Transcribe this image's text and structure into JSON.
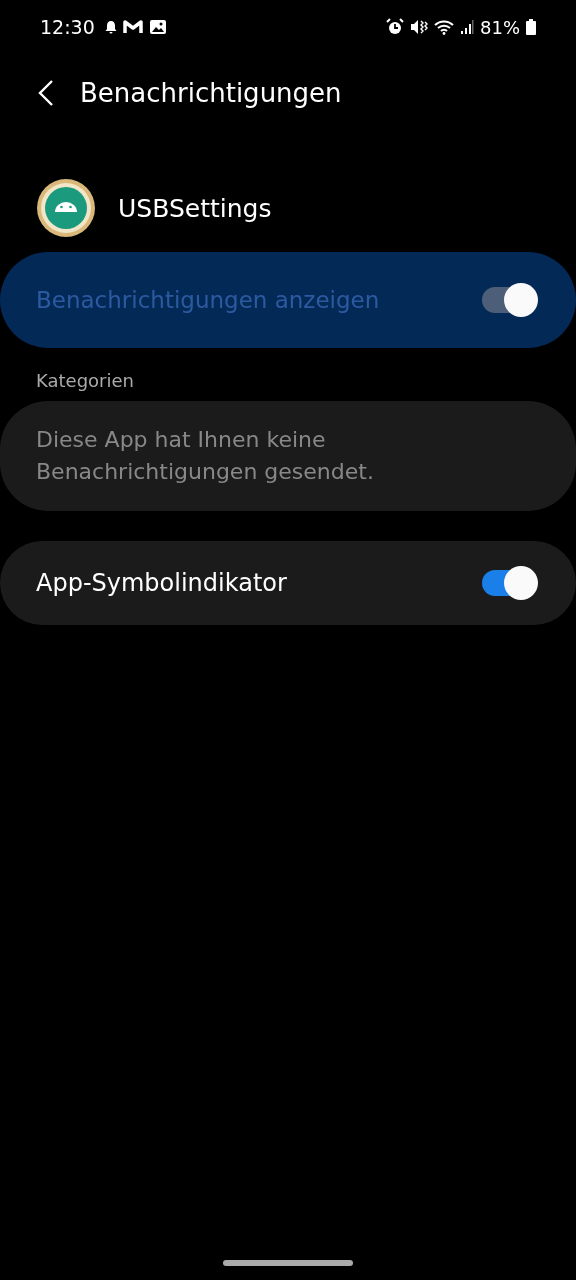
{
  "status_bar": {
    "time": "12:30",
    "battery": "81%"
  },
  "header": {
    "title": "Benachrichtigungen"
  },
  "app": {
    "name": "USBSettings"
  },
  "master_switch": {
    "label": "Benachrichtigungen anzeigen",
    "on": true,
    "disabled": true,
    "highlighted": true
  },
  "categories": {
    "heading": "Kategorien",
    "empty_text": "Diese App hat Ihnen keine Benachrichtigungen gesendet."
  },
  "settings": [
    {
      "label": "App-Symbolindikator",
      "on": true,
      "disabled": false
    }
  ]
}
